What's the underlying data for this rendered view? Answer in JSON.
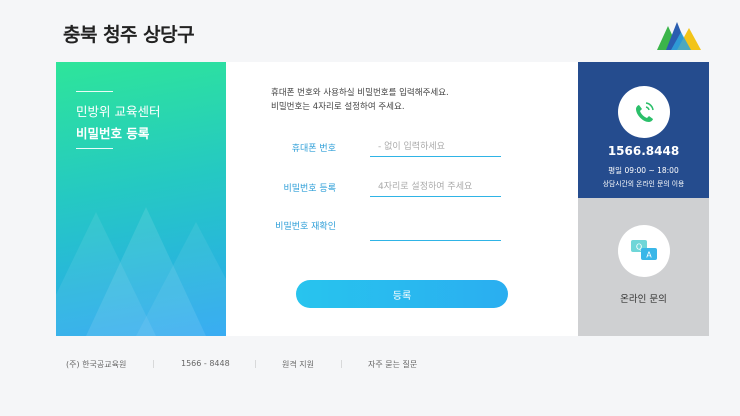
{
  "header": {
    "title": "충북 청주 상당구",
    "logo": "mountain-logo"
  },
  "left_panel": {
    "subtitle": "민방위 교육센터",
    "title": "비밀번호 등록"
  },
  "instructions": {
    "line1": "휴대폰 번호와 사용하실 비밀번호를 입력해주세요.",
    "line2": "비밀번호는 4자리로 설정하여 주세요."
  },
  "form": {
    "phone_label": "휴대폰 번호",
    "phone_placeholder": "- 없이 입력하세요",
    "password_label": "비밀번호 등록",
    "password_placeholder": "4자리로 설정하여 주세요",
    "confirm_label": "비밀번호 재확인",
    "confirm_placeholder": "",
    "submit_label": "등록"
  },
  "contact": {
    "phone_number": "1566.8448",
    "hours": "평일 09:00 ~ 18:00",
    "note": "상담시간외 온라인 문의 이용",
    "inquiry_label": "온라인 문의",
    "phone_icon": "phone-icon",
    "inquiry_icon": "qa-chat-icon"
  },
  "footer": {
    "company": "(주) 한국공교육원",
    "phone": "1566 - 8448",
    "remote": "원격 지원",
    "faq": "자주 묻는 질문"
  },
  "colors": {
    "accent": "#2fb4e6",
    "phone_panel": "#254c8e",
    "inquiry_panel": "#cfd0d2",
    "gradient_start": "#2ee59a",
    "gradient_end": "#2aa6f2"
  }
}
